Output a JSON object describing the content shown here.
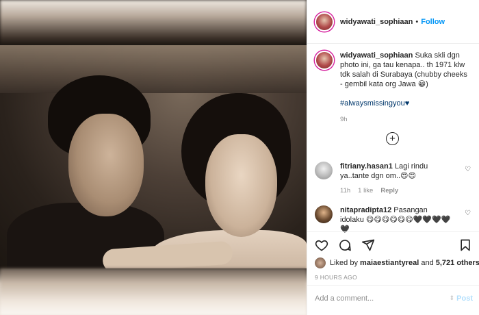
{
  "post": {
    "username": "widyawati_sophiaan",
    "follow_separator": "•",
    "follow_label": "Follow",
    "caption_username": "widyawati_sophiaan",
    "caption_text": "Suka skli dgn photo ini, ga tau kenapa.. th 1971 klw tdk salah di Surabaya (chubby cheeks - gembil kata org Jawa 😀)",
    "hashtag": "#alwaysmissingyou♥",
    "caption_time": "9h",
    "load_more_label": "+"
  },
  "comments": [
    {
      "username": "fitriany.hasan1",
      "text": "Lagi rindu ya..tante dgn om..😍😍",
      "time": "11h",
      "likes": "1 like",
      "reply": "Reply",
      "heart": "♡"
    },
    {
      "username": "nitapradipta12",
      "text": "Pasangan idolaku 😋😋😋😋😋😋🖤🖤🖤🖤🖤",
      "heart": "♡"
    }
  ],
  "likes_bar": {
    "prefix": "Liked by",
    "liker": "maiaestiantyreal",
    "connector": "and",
    "count_text": "5,721 others",
    "time_ago": "9 HOURS AGO"
  },
  "comment_box": {
    "placeholder": "Add a comment...",
    "post_label": "Post"
  },
  "colors": {
    "accent": "#0095f6",
    "muted": "#8e8e8e",
    "hashtag": "#00376b",
    "post_disabled": "#b2dffc"
  },
  "icons": [
    "heart-icon",
    "comment-icon",
    "share-icon",
    "bookmark-icon",
    "plus-circle-icon",
    "small-heart-icon"
  ]
}
